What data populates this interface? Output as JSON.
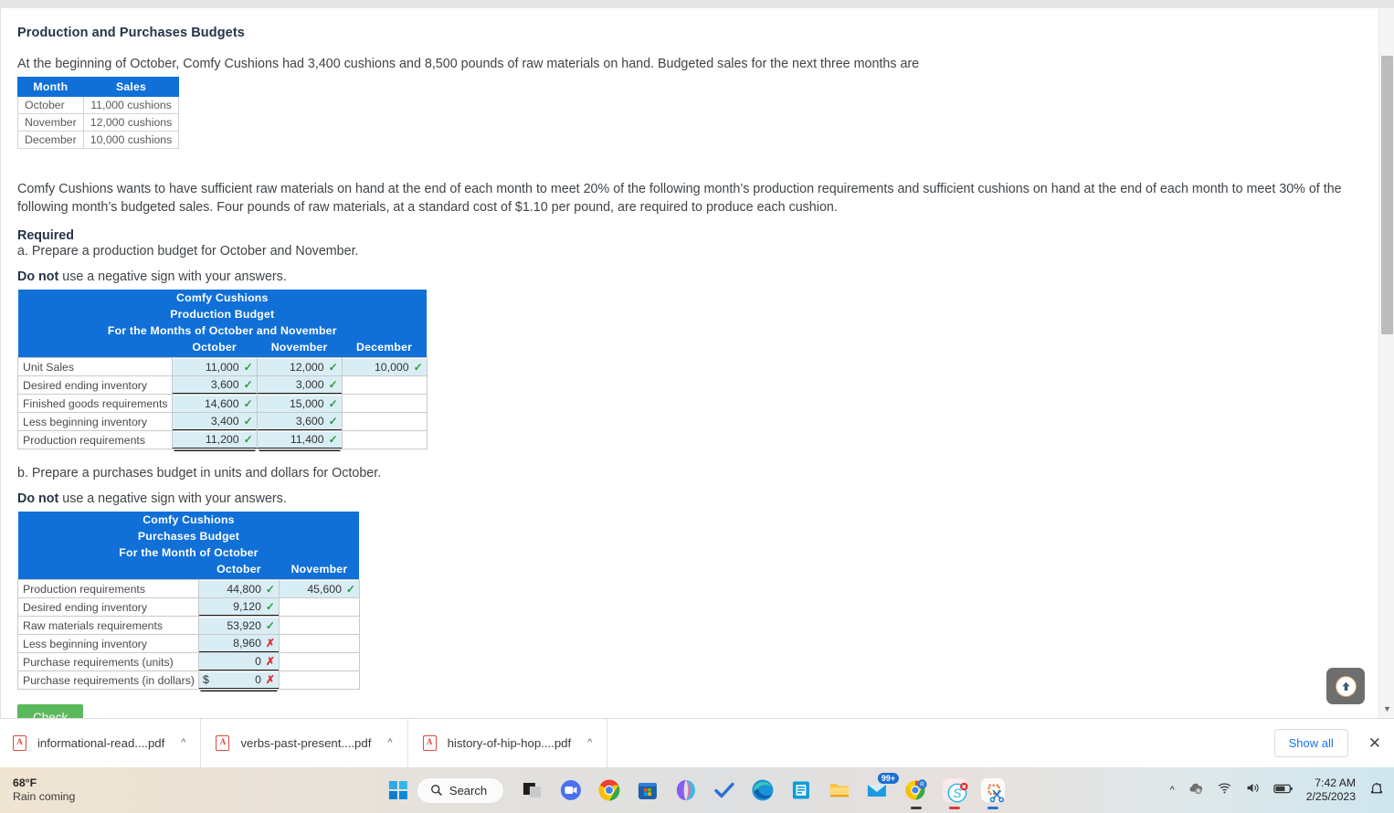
{
  "question": {
    "title": "Production and Purchases Budgets",
    "intro": "At the beginning of October, Comfy Cushions had 3,400 cushions and 8,500 pounds of raw materials on hand. Budgeted sales for the next three months are",
    "paragraph": "Comfy Cushions wants to have sufficient raw materials on hand at the end of each month to meet 20% of the following month’s production requirements and sufficient cushions on hand at the end of each month to meet 30% of the following month’s budgeted sales. Four pounds of raw materials, at a standard cost of $1.10 per pound, are required to produce each cushion.",
    "required_label": "Required",
    "req_a": "a. Prepare a production budget for October and November.",
    "req_b": "b. Prepare a purchases budget in units and dollars for October.",
    "donot_bold": "Do not",
    "donot_rest": " use a negative sign with your answers."
  },
  "sales_table": {
    "headers": [
      "Month",
      "Sales"
    ],
    "rows": [
      [
        "October",
        "11,000 cushions"
      ],
      [
        "November",
        "12,000 cushions"
      ],
      [
        "December",
        "10,000 cushions"
      ]
    ]
  },
  "production_budget": {
    "company": "Comfy Cushions",
    "report": "Production Budget",
    "period": "For the Months of October and November",
    "columns": [
      "October",
      "November",
      "December"
    ],
    "rows": [
      {
        "label": "Unit Sales",
        "cells": [
          {
            "value": "11,000",
            "mark": "check",
            "filled": true,
            "underline": "none"
          },
          {
            "value": "12,000",
            "mark": "check",
            "filled": true,
            "underline": "none"
          },
          {
            "value": "10,000",
            "mark": "check",
            "filled": true,
            "underline": "none"
          }
        ]
      },
      {
        "label": "Desired ending inventory",
        "cells": [
          {
            "value": "3,600",
            "mark": "check",
            "filled": true,
            "underline": "single"
          },
          {
            "value": "3,000",
            "mark": "check",
            "filled": true,
            "underline": "single"
          },
          {
            "value": "",
            "mark": "none",
            "filled": false,
            "underline": "none"
          }
        ]
      },
      {
        "label": "Finished goods requirements",
        "cells": [
          {
            "value": "14,600",
            "mark": "check",
            "filled": true,
            "underline": "none"
          },
          {
            "value": "15,000",
            "mark": "check",
            "filled": true,
            "underline": "none"
          },
          {
            "value": "",
            "mark": "none",
            "filled": false,
            "underline": "none"
          }
        ]
      },
      {
        "label": "Less beginning inventory",
        "cells": [
          {
            "value": "3,400",
            "mark": "check",
            "filled": true,
            "underline": "single"
          },
          {
            "value": "3,600",
            "mark": "check",
            "filled": true,
            "underline": "single"
          },
          {
            "value": "",
            "mark": "none",
            "filled": false,
            "underline": "none"
          }
        ]
      },
      {
        "label": "Production requirements",
        "cells": [
          {
            "value": "11,200",
            "mark": "check",
            "filled": true,
            "underline": "double"
          },
          {
            "value": "11,400",
            "mark": "check",
            "filled": true,
            "underline": "double"
          },
          {
            "value": "",
            "mark": "none",
            "filled": false,
            "underline": "none"
          }
        ]
      }
    ]
  },
  "purchases_budget": {
    "company": "Comfy Cushions",
    "report": "Purchases Budget",
    "period": "For the Month of October",
    "columns": [
      "October",
      "November"
    ],
    "rows": [
      {
        "label": "Production requirements",
        "cells": [
          {
            "value": "44,800",
            "mark": "check",
            "filled": true,
            "underline": "none",
            "prefix": ""
          },
          {
            "value": "45,600",
            "mark": "check",
            "filled": true,
            "underline": "none",
            "prefix": ""
          }
        ]
      },
      {
        "label": "Desired ending inventory",
        "cells": [
          {
            "value": "9,120",
            "mark": "check",
            "filled": true,
            "underline": "single",
            "prefix": ""
          },
          {
            "value": "",
            "mark": "none",
            "filled": false,
            "underline": "none",
            "prefix": ""
          }
        ]
      },
      {
        "label": "Raw materials requirements",
        "cells": [
          {
            "value": "53,920",
            "mark": "check",
            "filled": true,
            "underline": "none",
            "prefix": ""
          },
          {
            "value": "",
            "mark": "none",
            "filled": false,
            "underline": "none",
            "prefix": ""
          }
        ]
      },
      {
        "label": "Less beginning inventory",
        "cells": [
          {
            "value": "8,960",
            "mark": "cross",
            "filled": true,
            "underline": "single",
            "prefix": ""
          },
          {
            "value": "",
            "mark": "none",
            "filled": false,
            "underline": "none",
            "prefix": ""
          }
        ]
      },
      {
        "label": "Purchase requirements (units)",
        "cells": [
          {
            "value": "0",
            "mark": "cross",
            "filled": true,
            "underline": "single",
            "prefix": ""
          },
          {
            "value": "",
            "mark": "none",
            "filled": false,
            "underline": "none",
            "prefix": ""
          }
        ]
      },
      {
        "label": "Purchase requirements (in dollars)",
        "cells": [
          {
            "value": "0",
            "mark": "cross",
            "filled": true,
            "underline": "double",
            "prefix": "$"
          },
          {
            "value": "",
            "mark": "none",
            "filled": false,
            "underline": "none",
            "prefix": ""
          }
        ]
      }
    ]
  },
  "check_button": {
    "label": "Check"
  },
  "downloads": {
    "items": [
      {
        "filename": "informational-read....pdf"
      },
      {
        "filename": "verbs-past-present....pdf"
      },
      {
        "filename": "history-of-hip-hop....pdf"
      }
    ],
    "show_all": "Show all",
    "close": "✕"
  },
  "taskbar": {
    "weather_temp": "68°F",
    "weather_cond": "Rain coming",
    "search_label": "Search",
    "mail_badge": "99+",
    "time": "7:42 AM",
    "date": "2/25/2023"
  },
  "colors": {
    "header_blue": "#1070d8",
    "cell_fill": "#d9edf4",
    "check_green": "#5cb85c",
    "correct_green": "#2e9b41",
    "wrong_red": "#e03030",
    "link_blue": "#1a73e8"
  }
}
